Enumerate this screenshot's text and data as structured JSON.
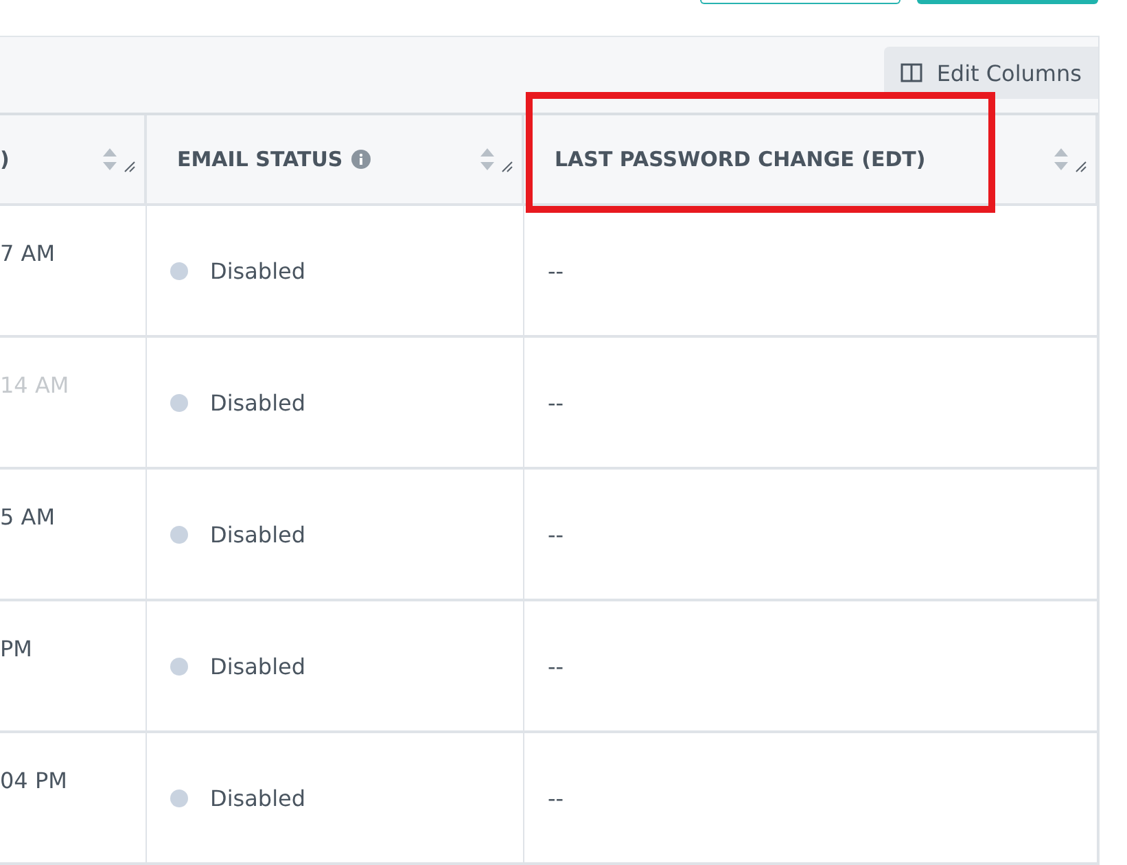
{
  "top_buttons": [
    {
      "kind": "outline"
    },
    {
      "kind": "filled"
    }
  ],
  "toolbar": {
    "edit_columns": "Edit Columns"
  },
  "table": {
    "columns": [
      {
        "label": ")",
        "info": false,
        "highlighted": false
      },
      {
        "label": "EMAIL STATUS",
        "info": true,
        "highlighted": false
      },
      {
        "label": "LAST PASSWORD CHANGE (EDT)",
        "info": false,
        "highlighted": true
      }
    ],
    "rows": [
      {
        "time": "7 AM",
        "dimmed": false,
        "status": "Disabled",
        "color": "#c9d3e0",
        "last_change": "--"
      },
      {
        "time": "14 AM",
        "dimmed": true,
        "status": "Disabled",
        "color": "#c9d3e0",
        "last_change": "--"
      },
      {
        "time": "5 AM",
        "dimmed": false,
        "status": "Disabled",
        "color": "#c9d3e0",
        "last_change": "--"
      },
      {
        "time": "PM",
        "dimmed": false,
        "status": "Disabled",
        "color": "#c9d3e0",
        "last_change": "--"
      },
      {
        "time": "04 PM",
        "dimmed": false,
        "status": "Disabled",
        "color": "#c9d3e0",
        "last_change": "--"
      }
    ]
  }
}
